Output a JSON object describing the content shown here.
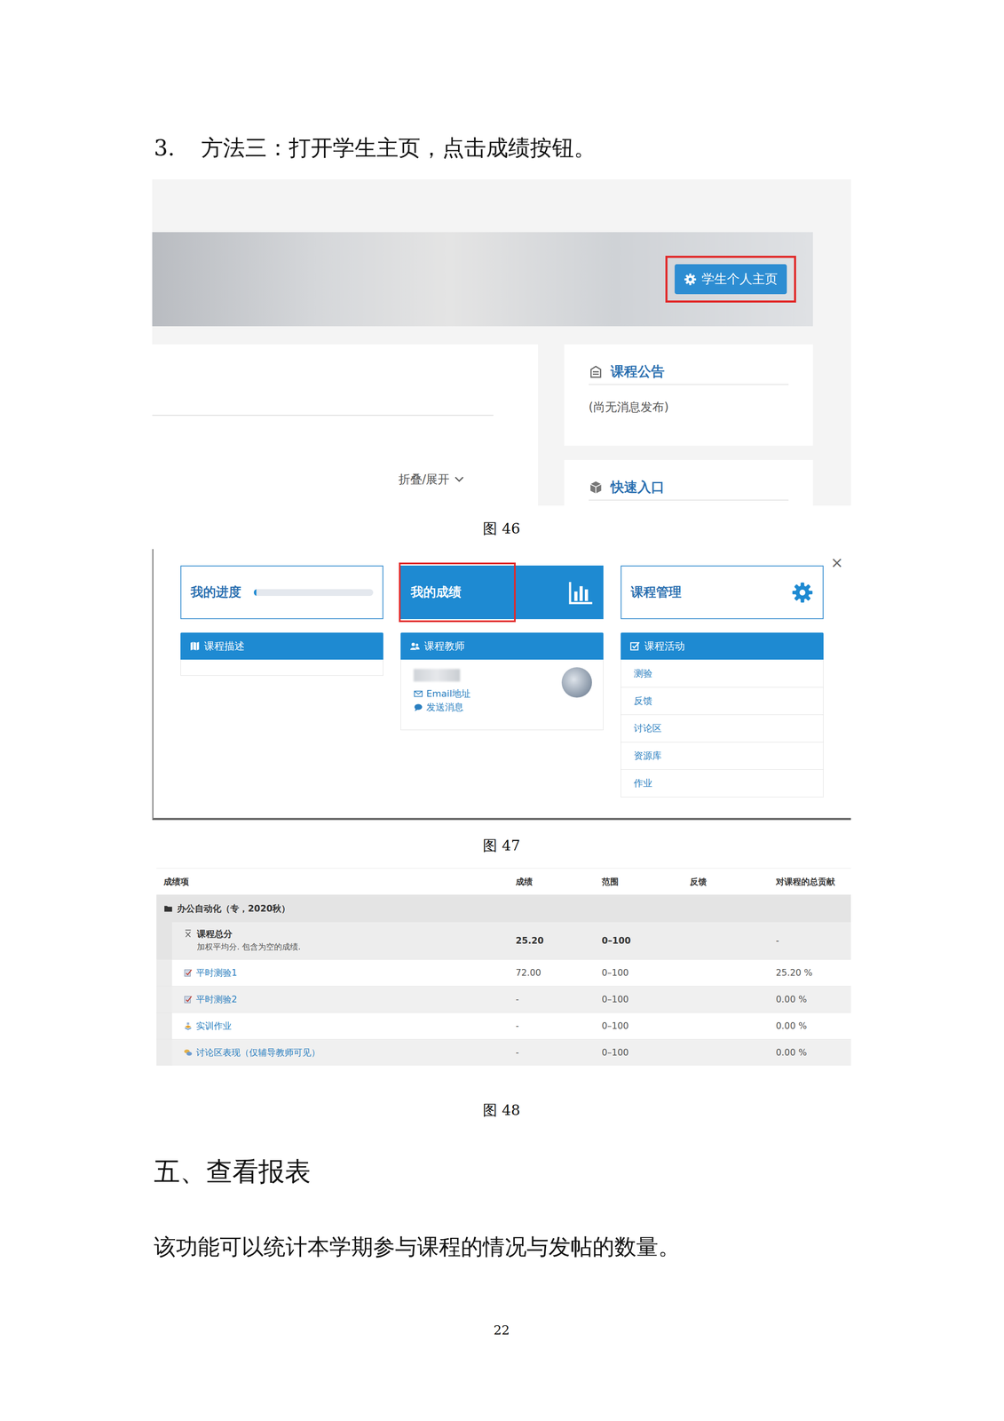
{
  "heading": {
    "number": "3.",
    "text": "方法三：打开学生主页，点击成绩按钮。"
  },
  "figure46": {
    "button": {
      "label": "学生个人主页",
      "highlighted": true
    },
    "announcements": {
      "title": "课程公告",
      "body": "(尚无消息发布)"
    },
    "quick_entry": {
      "title": "快速入口"
    },
    "toggle": "折叠/展开"
  },
  "figure47": {
    "close": "×",
    "tiles": [
      {
        "label": "我的进度",
        "kind": "progress",
        "level": 0.02,
        "selected": false,
        "highlighted": false
      },
      {
        "label": "我的成绩",
        "kind": "chart",
        "selected": true,
        "highlighted": true
      },
      {
        "label": "课程管理",
        "kind": "settings",
        "selected": false,
        "highlighted": false
      }
    ],
    "description": {
      "title": "课程描述"
    },
    "teacher": {
      "title": "课程教师",
      "links": [
        "Email地址",
        "发送消息"
      ]
    },
    "activities": {
      "title": "课程活动",
      "items": [
        "测验",
        "反馈",
        "讨论区",
        "资源库",
        "作业"
      ]
    }
  },
  "figure48": {
    "columns": [
      "成绩项",
      "成绩",
      "范围",
      "反馈",
      "对课程的总贡献"
    ],
    "category": "办公自动化（专，2020秋）",
    "total": {
      "name": "课程总分",
      "note": "加权平均分. 包含为空的成绩.",
      "grade": "25.20",
      "range": "0–100",
      "contribution": "-"
    },
    "rows": [
      {
        "kind": "quiz",
        "name": "平时测验1",
        "grade": "72.00",
        "range": "0–100",
        "contribution": "25.20 %"
      },
      {
        "kind": "quiz",
        "name": "平时测验2",
        "grade": "-",
        "range": "0–100",
        "contribution": "0.00 %"
      },
      {
        "kind": "assignment",
        "name": "实训作业",
        "grade": "-",
        "range": "0–100",
        "contribution": "0.00 %"
      },
      {
        "kind": "forum",
        "name": "讨论区表现（仅辅导教师可见）",
        "grade": "-",
        "range": "0–100",
        "contribution": "0.00 %"
      }
    ]
  },
  "captions": [
    "图 46",
    "图 47",
    "图 48"
  ],
  "section": {
    "title": "五、查看报表",
    "text": "该功能可以统计本学期参与课程的情况与发帖的数量。"
  },
  "page_number": "22"
}
